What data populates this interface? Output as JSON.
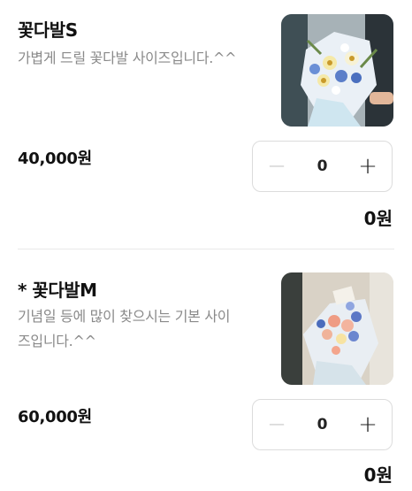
{
  "products": [
    {
      "title": "꽃다발S",
      "description_lines": [
        "가볍게 드릴 꽃다발 사이즈입니다.^^"
      ],
      "price": "40,000원",
      "quantity": "0",
      "subtotal": "0원",
      "minus_symbol": "−",
      "plus_symbol": "+"
    },
    {
      "title": "* 꽃다발M",
      "description_lines": [
        "기념일 등에 많이 찾으시는 기본 사이",
        "즈입니다.^^"
      ],
      "price": "60,000원",
      "quantity": "0",
      "subtotal": "0원",
      "minus_symbol": "−",
      "plus_symbol": "+"
    }
  ],
  "colors": {
    "stepper_border": "#dcdcdc",
    "minus_disabled": "#c7c7c7",
    "description": "#8a8a8a"
  },
  "icons": {
    "minus": "minus-icon",
    "plus": "plus-icon"
  }
}
